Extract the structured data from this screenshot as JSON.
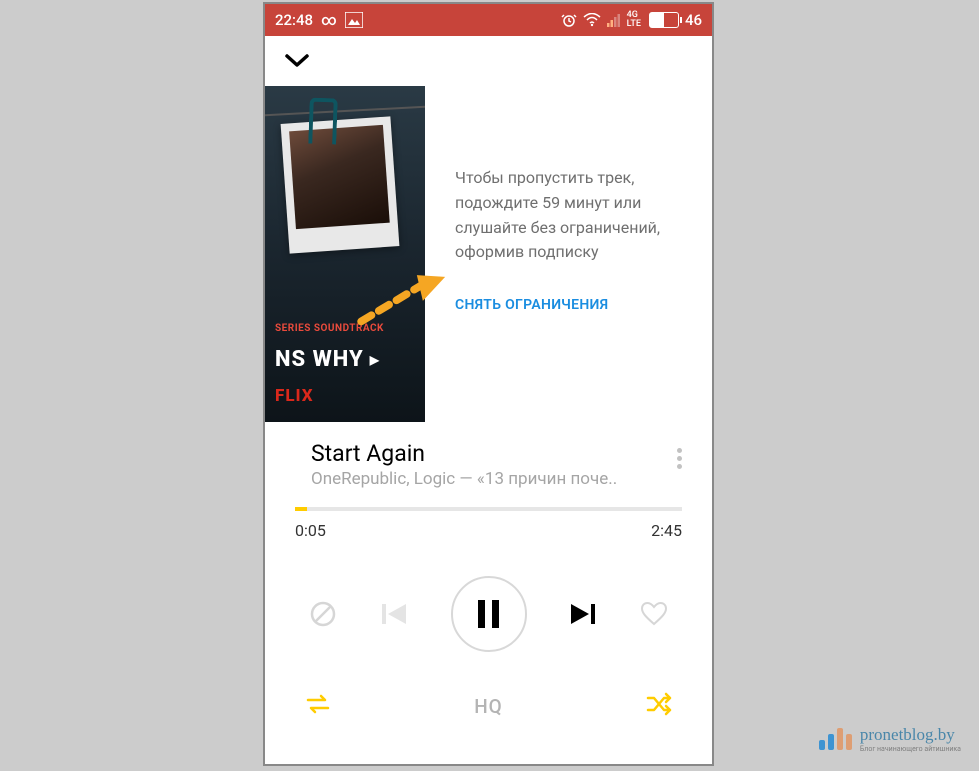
{
  "status": {
    "time": "22:48",
    "lte": "4G LTE",
    "battery": "46",
    "infinity": "∞",
    "image_icon": "image-icon",
    "alarm_icon": "alarm-icon",
    "wifi_icon": "wifi-icon",
    "signal_icon": "signal-icon"
  },
  "album": {
    "series": "SERIES SOUNDTRACK",
    "title": "NS WHY",
    "brand": "FLIX"
  },
  "promo": {
    "text": "Чтобы пропустить трек, подождите 59 минут или слушайте без ограничений, оформив подписку",
    "link": "СНЯТЬ ОГРАНИЧЕНИЯ"
  },
  "track": {
    "title": "Start Again",
    "artist": "OneRepublic, Logic — «13 причин поче.."
  },
  "progress": {
    "elapsed": "0:05",
    "total": "2:45"
  },
  "bottom": {
    "hq": "HQ"
  },
  "watermark": {
    "text": "pronetblog.by",
    "sub": "Блог начинающего айтишника"
  }
}
